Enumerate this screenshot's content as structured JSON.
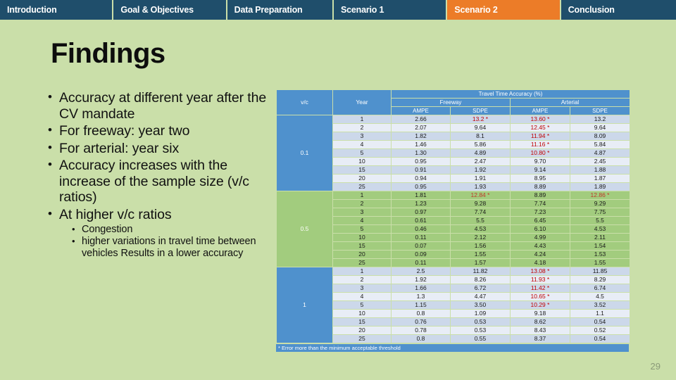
{
  "nav": {
    "tabs": [
      {
        "label": "Introduction",
        "active": false
      },
      {
        "label": "Goal & Objectives",
        "active": false
      },
      {
        "label": "Data Preparation",
        "active": false
      },
      {
        "label": "Scenario 1",
        "active": false
      },
      {
        "label": "Scenario 2",
        "active": true
      },
      {
        "label": "Conclusion",
        "active": false
      }
    ],
    "active_color": "#ec7c28",
    "inactive_color": "#1f4e6b"
  },
  "slide": {
    "title": "Findings",
    "page_number": "29",
    "background_color": "#cadfa9"
  },
  "bullets": {
    "level1": [
      "Accuracy at different year after the CV mandate",
      "For freeway: year two",
      "For arterial: year six",
      "Accuracy increases with the increase of the sample size (v/c ratios)",
      "At higher v/c ratios"
    ],
    "level2": [
      "Congestion",
      "higher variations in travel time between vehicles Results in a lower accuracy"
    ]
  },
  "table": {
    "col_vc": "v/c",
    "col_year": "Year",
    "group_top": "Travel Time Accuracy (%)",
    "group_freeway": "Freeway",
    "group_arterial": "Arterial",
    "sub_ampe": "AMPE",
    "sub_sdpe": "SDPE",
    "footnote": "* Error more than the minimum acceptable threshold",
    "error_color": "#c00000",
    "header_color": "#4f91cd",
    "blocks": [
      {
        "vc": "0.1",
        "style": "blue",
        "rows": [
          {
            "year": "1",
            "fw_ampe": "2.66",
            "fw_sdpe": "13.2 *",
            "ar_ampe": "13.60 *",
            "ar_sdpe": "13.2",
            "err": [
              "fw_sdpe",
              "ar_ampe"
            ]
          },
          {
            "year": "2",
            "fw_ampe": "2.07",
            "fw_sdpe": "9.64",
            "ar_ampe": "12.45 *",
            "ar_sdpe": "9.64",
            "err": [
              "ar_ampe"
            ]
          },
          {
            "year": "3",
            "fw_ampe": "1.82",
            "fw_sdpe": "8.1",
            "ar_ampe": "11.94 *",
            "ar_sdpe": "8.09",
            "err": [
              "ar_ampe"
            ]
          },
          {
            "year": "4",
            "fw_ampe": "1.46",
            "fw_sdpe": "5.86",
            "ar_ampe": "11.16 *",
            "ar_sdpe": "5.84",
            "err": [
              "ar_ampe"
            ]
          },
          {
            "year": "5",
            "fw_ampe": "1.30",
            "fw_sdpe": "4.89",
            "ar_ampe": "10.80 *",
            "ar_sdpe": "4.87",
            "err": [
              "ar_ampe"
            ]
          },
          {
            "year": "10",
            "fw_ampe": "0.95",
            "fw_sdpe": "2.47",
            "ar_ampe": "9.70",
            "ar_sdpe": "2.45",
            "err": []
          },
          {
            "year": "15",
            "fw_ampe": "0.91",
            "fw_sdpe": "1.92",
            "ar_ampe": "9.14",
            "ar_sdpe": "1.88",
            "err": []
          },
          {
            "year": "20",
            "fw_ampe": "0.94",
            "fw_sdpe": "1.91",
            "ar_ampe": "8.95",
            "ar_sdpe": "1.87",
            "err": []
          },
          {
            "year": "25",
            "fw_ampe": "0.95",
            "fw_sdpe": "1.93",
            "ar_ampe": "8.89",
            "ar_sdpe": "1.89",
            "err": []
          }
        ]
      },
      {
        "vc": "0.5",
        "style": "green",
        "rows": [
          {
            "year": "1",
            "fw_ampe": "1.81",
            "fw_sdpe": "12.84 *",
            "ar_ampe": "8.89",
            "ar_sdpe": "12.86 *",
            "err": [
              "fw_sdpe",
              "ar_sdpe"
            ]
          },
          {
            "year": "2",
            "fw_ampe": "1.23",
            "fw_sdpe": "9.28",
            "ar_ampe": "7.74",
            "ar_sdpe": "9.29",
            "err": []
          },
          {
            "year": "3",
            "fw_ampe": "0.97",
            "fw_sdpe": "7.74",
            "ar_ampe": "7.23",
            "ar_sdpe": "7.75",
            "err": []
          },
          {
            "year": "4",
            "fw_ampe": "0.61",
            "fw_sdpe": "5.5",
            "ar_ampe": "6.45",
            "ar_sdpe": "5.5",
            "err": []
          },
          {
            "year": "5",
            "fw_ampe": "0.46",
            "fw_sdpe": "4.53",
            "ar_ampe": "6.10",
            "ar_sdpe": "4.53",
            "err": []
          },
          {
            "year": "10",
            "fw_ampe": "0.11",
            "fw_sdpe": "2.12",
            "ar_ampe": "4.99",
            "ar_sdpe": "2.11",
            "err": []
          },
          {
            "year": "15",
            "fw_ampe": "0.07",
            "fw_sdpe": "1.56",
            "ar_ampe": "4.43",
            "ar_sdpe": "1.54",
            "err": []
          },
          {
            "year": "20",
            "fw_ampe": "0.09",
            "fw_sdpe": "1.55",
            "ar_ampe": "4.24",
            "ar_sdpe": "1.53",
            "err": []
          },
          {
            "year": "25",
            "fw_ampe": "0.11",
            "fw_sdpe": "1.57",
            "ar_ampe": "4.18",
            "ar_sdpe": "1.55",
            "err": []
          }
        ]
      },
      {
        "vc": "1",
        "style": "blue",
        "rows": [
          {
            "year": "1",
            "fw_ampe": "2.5",
            "fw_sdpe": "11.82",
            "ar_ampe": "13.08 *",
            "ar_sdpe": "11.85",
            "err": [
              "ar_ampe"
            ]
          },
          {
            "year": "2",
            "fw_ampe": "1.92",
            "fw_sdpe": "8.26",
            "ar_ampe": "11.93 *",
            "ar_sdpe": "8.29",
            "err": [
              "ar_ampe"
            ]
          },
          {
            "year": "3",
            "fw_ampe": "1.66",
            "fw_sdpe": "6.72",
            "ar_ampe": "11.42 *",
            "ar_sdpe": "6.74",
            "err": [
              "ar_ampe"
            ]
          },
          {
            "year": "4",
            "fw_ampe": "1.3",
            "fw_sdpe": "4.47",
            "ar_ampe": "10.65 *",
            "ar_sdpe": "4.5",
            "err": [
              "ar_ampe"
            ]
          },
          {
            "year": "5",
            "fw_ampe": "1.15",
            "fw_sdpe": "3.50",
            "ar_ampe": "10.29 *",
            "ar_sdpe": "3.52",
            "err": [
              "ar_ampe"
            ]
          },
          {
            "year": "10",
            "fw_ampe": "0.8",
            "fw_sdpe": "1.09",
            "ar_ampe": "9.18",
            "ar_sdpe": "1.1",
            "err": []
          },
          {
            "year": "15",
            "fw_ampe": "0.76",
            "fw_sdpe": "0.53",
            "ar_ampe": "8.62",
            "ar_sdpe": "0.54",
            "err": []
          },
          {
            "year": "20",
            "fw_ampe": "0.78",
            "fw_sdpe": "0.53",
            "ar_ampe": "8.43",
            "ar_sdpe": "0.52",
            "err": []
          },
          {
            "year": "25",
            "fw_ampe": "0.8",
            "fw_sdpe": "0.55",
            "ar_ampe": "8.37",
            "ar_sdpe": "0.54",
            "err": []
          }
        ]
      }
    ]
  }
}
